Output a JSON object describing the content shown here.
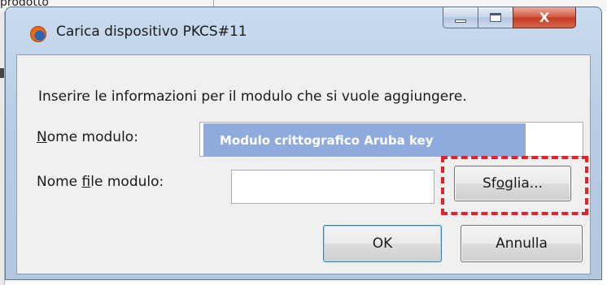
{
  "background": {
    "partial_text": "prodotto"
  },
  "window": {
    "title": "Carica dispositivo PKCS#11",
    "icon": "firefox-icon",
    "controls": {
      "minimize_icon": "minimize-icon",
      "maximize_icon": "maximize-icon",
      "close_glyph": "X"
    }
  },
  "form": {
    "instruction": "Inserire le informazioni per il modulo che si vuole aggiungere.",
    "module_name": {
      "label_accel": "N",
      "label_rest": "ome modulo:",
      "value": "Modulo crittografico Aruba key"
    },
    "module_file": {
      "label_pre": "Nome ",
      "label_accel": "f",
      "label_post": "ile modulo:",
      "value": ""
    },
    "browse_button": {
      "pre": "Sf",
      "accel": "o",
      "post": "glia..."
    }
  },
  "buttons": {
    "ok": "OK",
    "cancel": "Annulla"
  },
  "annotation": {
    "highlight_color": "#e8202a",
    "target": "browse_button"
  },
  "colors": {
    "selection": "#8faadc",
    "titlebar": "#b9cde4",
    "close": "#c23b22"
  }
}
